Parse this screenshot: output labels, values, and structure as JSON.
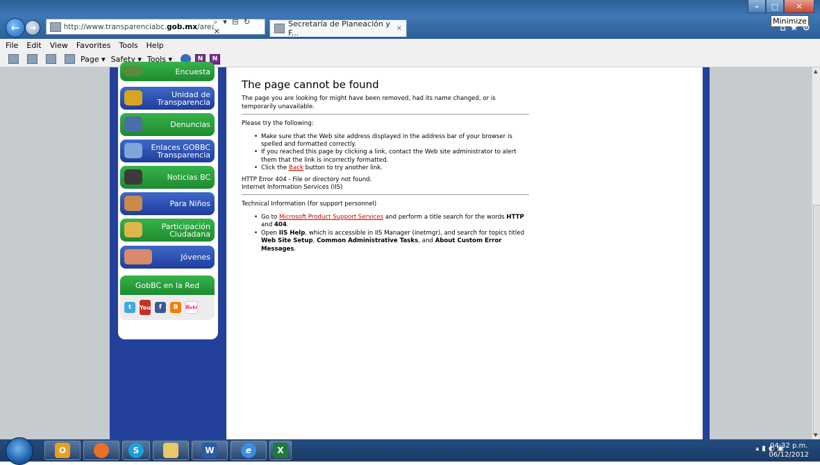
{
  "browser": {
    "address": {
      "url_prefix": "http://www.",
      "url_domain_start": "transparenciabc.",
      "url_domain_bold": "gob.mx",
      "url_rest": "/areas/spf.h",
      "controls": "⌕ ▾ ⊟ ↻ ✕"
    },
    "tab_title": "Secretaría de Planeación y F...",
    "tab_close": "✕",
    "tooltip": "Minimize",
    "menu": [
      "File",
      "Edit",
      "View",
      "Favorites",
      "Tools",
      "Help"
    ],
    "commands": {
      "page": "Page ▾",
      "safety": "Safety ▾",
      "tools": "Tools ▾"
    }
  },
  "sidebar": {
    "items": [
      {
        "label": "Encuesta",
        "color": "green"
      },
      {
        "label": "Unidad de\nTransparencia",
        "color": "blue"
      },
      {
        "label": "Denuncias",
        "color": "green"
      },
      {
        "label": "Enlaces GOBBC\nTransparencia",
        "color": "blue"
      },
      {
        "label": "Noticias BC",
        "color": "green"
      },
      {
        "label": "Para Niños",
        "color": "blue"
      },
      {
        "label": "Participación\nCiudadana",
        "color": "green"
      },
      {
        "label": "Jóvenes",
        "color": "blue"
      }
    ],
    "social_title": "GobBC en la Red",
    "social_icons": [
      "twitter-icon",
      "youtube-icon",
      "facebook-icon",
      "blogger-icon",
      "flickr-icon"
    ]
  },
  "error": {
    "title": "The page cannot be found",
    "intro": "The page you are looking for might have been removed, had its name changed, or is temporarily unavailable.",
    "try_heading": "Please try the following:",
    "bullet1": "Make sure that the Web site address displayed in the address bar of your browser is spelled and formatted correctly.",
    "bullet2": "If you reached this page by clicking a link, contact the Web site administrator to alert them that the link is incorrectly formatted.",
    "bullet3_pre": "Click the ",
    "bullet3_link": "Back",
    "bullet3_post": " button to try another link.",
    "http_error": "HTTP Error 404 - File or directory not found.",
    "iis": "Internet Information Services (IIS)",
    "tech_heading": "Technical Information (for support personnel)",
    "tech1_pre": "Go to ",
    "tech1_link": "Microsoft Product Support Services",
    "tech1_mid": " and perform a title search for the words ",
    "tech1_b1": "HTTP",
    "tech1_and": " and ",
    "tech1_b2": "404",
    "tech1_end": ".",
    "tech2_pre": "Open ",
    "tech2_b1": "IIS Help",
    "tech2_mid": ", which is accessible in IIS Manager (inetmgr), and search for topics titled ",
    "tech2_b2": "Web Site Setup",
    "tech2_sep": ", ",
    "tech2_b3": "Common Administrative Tasks",
    "tech2_and": ", and ",
    "tech2_b4": "About Custom Error Messages",
    "tech2_end": "."
  },
  "taskbar": {
    "apps": [
      "outlook-icon",
      "firefox-icon",
      "skype-icon",
      "explorer-icon",
      "word-icon",
      "ie-icon",
      "excel-icon"
    ],
    "time": "04:32 p.m.",
    "date": "06/12/2012"
  }
}
